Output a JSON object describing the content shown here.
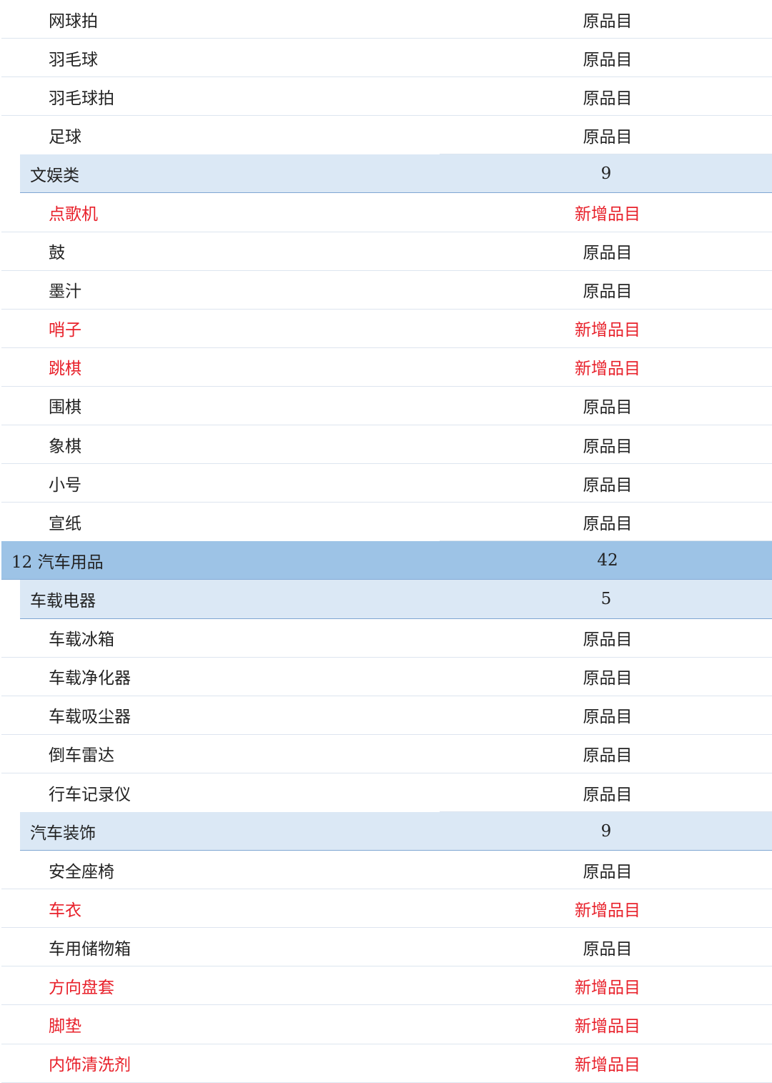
{
  "rows": [
    {
      "level": "item",
      "name": "网球拍",
      "value": "原品目",
      "is_new": false
    },
    {
      "level": "item",
      "name": "羽毛球",
      "value": "原品目",
      "is_new": false
    },
    {
      "level": "item",
      "name": "羽毛球拍",
      "value": "原品目",
      "is_new": false
    },
    {
      "level": "item",
      "name": "足球",
      "value": "原品目",
      "is_new": false
    },
    {
      "level": "sub",
      "name": "文娱类",
      "value": "9",
      "is_new": false
    },
    {
      "level": "item",
      "name": "点歌机",
      "value": "新增品目",
      "is_new": true
    },
    {
      "level": "item",
      "name": "鼓",
      "value": "原品目",
      "is_new": false
    },
    {
      "level": "item",
      "name": "墨汁",
      "value": "原品目",
      "is_new": false
    },
    {
      "level": "item",
      "name": "哨子",
      "value": "新增品目",
      "is_new": true
    },
    {
      "level": "item",
      "name": "跳棋",
      "value": "新增品目",
      "is_new": true
    },
    {
      "level": "item",
      "name": "围棋",
      "value": "原品目",
      "is_new": false
    },
    {
      "level": "item",
      "name": "象棋",
      "value": "原品目",
      "is_new": false
    },
    {
      "level": "item",
      "name": "小号",
      "value": "原品目",
      "is_new": false
    },
    {
      "level": "item",
      "name": "宣纸",
      "value": "原品目",
      "is_new": false
    },
    {
      "level": "top",
      "name": "12 汽车用品",
      "value": "42",
      "is_new": false
    },
    {
      "level": "sub",
      "name": "车载电器",
      "value": "5",
      "is_new": false
    },
    {
      "level": "item",
      "name": "车载冰箱",
      "value": "原品目",
      "is_new": false
    },
    {
      "level": "item",
      "name": "车载净化器",
      "value": "原品目",
      "is_new": false
    },
    {
      "level": "item",
      "name": "车载吸尘器",
      "value": "原品目",
      "is_new": false
    },
    {
      "level": "item",
      "name": "倒车雷达",
      "value": "原品目",
      "is_new": false
    },
    {
      "level": "item",
      "name": "行车记录仪",
      "value": "原品目",
      "is_new": false
    },
    {
      "level": "sub",
      "name": "汽车装饰",
      "value": "9",
      "is_new": false
    },
    {
      "level": "item",
      "name": "安全座椅",
      "value": "原品目",
      "is_new": false
    },
    {
      "level": "item",
      "name": "车衣",
      "value": "新增品目",
      "is_new": true
    },
    {
      "level": "item",
      "name": "车用储物箱",
      "value": "原品目",
      "is_new": false
    },
    {
      "level": "item",
      "name": "方向盘套",
      "value": "新增品目",
      "is_new": true
    },
    {
      "level": "item",
      "name": "脚垫",
      "value": "新增品目",
      "is_new": true
    },
    {
      "level": "item",
      "name": "内饰清洗剂",
      "value": "新增品目",
      "is_new": true
    }
  ],
  "colors": {
    "top_header_bg": "#9dc3e6",
    "sub_header_bg": "#dbe8f5",
    "new_item_text": "#e8202a",
    "normal_text": "#222222"
  }
}
